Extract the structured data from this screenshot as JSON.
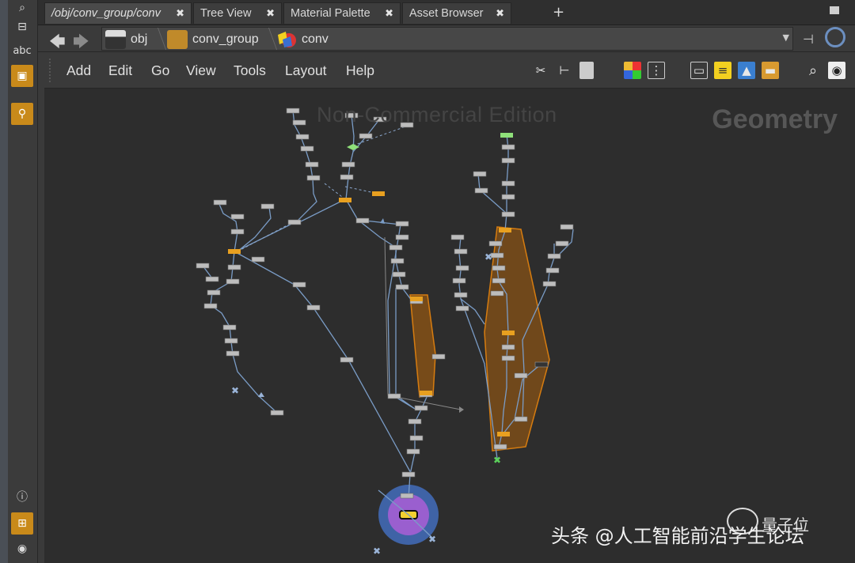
{
  "tabs": [
    {
      "label": "/obj/conv_group/conv",
      "active": true
    },
    {
      "label": "Tree View",
      "active": false
    },
    {
      "label": "Material Palette",
      "active": false
    },
    {
      "label": "Asset Browser",
      "active": false
    }
  ],
  "tab_close_glyph": "✖",
  "tab_add_glyph": "+",
  "shelf": {
    "text_tool_label": "abc"
  },
  "path": {
    "crumbs": [
      {
        "label": "obj",
        "icon": "clapboard-icon"
      },
      {
        "label": "conv_group",
        "icon": "subnet-icon"
      },
      {
        "label": "conv",
        "icon": "geometry-icon"
      }
    ]
  },
  "menu": [
    "Add",
    "Edit",
    "Go",
    "View",
    "Tools",
    "Layout",
    "Help"
  ],
  "network": {
    "watermark": "Non-Commercial Edition",
    "context_label": "Geometry"
  },
  "overlay": {
    "credit": "头条 @人工智能前沿学生论坛",
    "brand": "量子位"
  },
  "colors": {
    "node_default": "#bdbdbd",
    "node_selected": "#e8a020",
    "group_box": "#b4640a",
    "wire": "#7a9cc6",
    "accent_orange": "#c98a1a",
    "display_ring": "#4a6fb0",
    "display_node": "#a070d0"
  }
}
